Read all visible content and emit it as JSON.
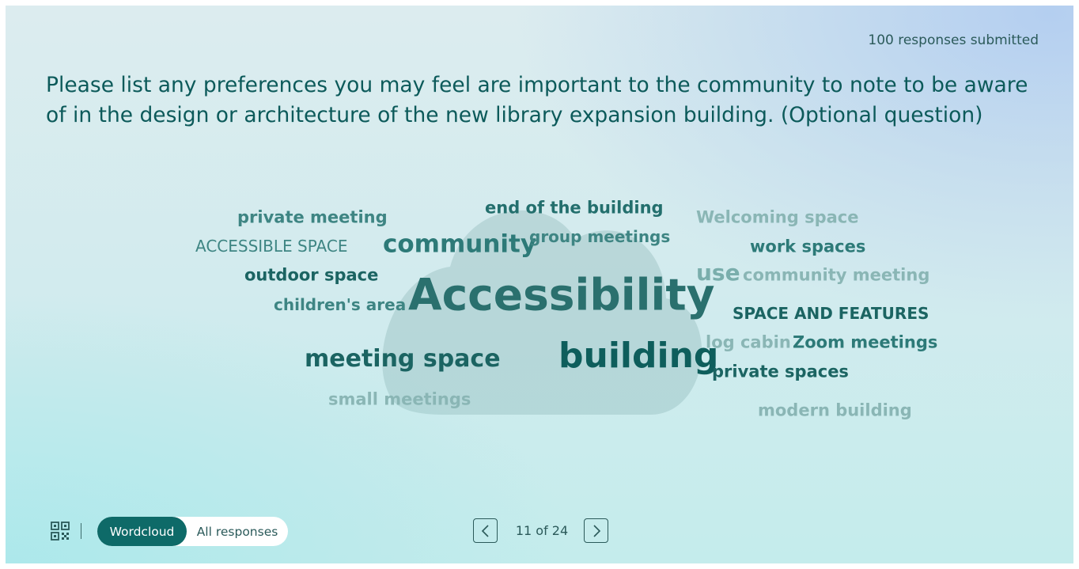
{
  "header": {
    "responses_text": "100 responses submitted",
    "question": "Please list any preferences you may feel are important to the community to note to be aware of in the design or architecture of the new library expansion building. (Optional question)"
  },
  "wordcloud": {
    "words": [
      {
        "text": "private meeting",
        "color": "#3e8583"
      },
      {
        "text": "end of the building",
        "color": "#236f6d"
      },
      {
        "text": "Welcoming space",
        "color": "#8ab6b5"
      },
      {
        "text": "ACCESSIBLE SPACE",
        "color": "#3e8583"
      },
      {
        "text": "community",
        "color": "#2d7a78"
      },
      {
        "text": "group meetings",
        "color": "#3e8583"
      },
      {
        "text": "work spaces",
        "color": "#2d7a78"
      },
      {
        "text": "outdoor space",
        "color": "#1b6462"
      },
      {
        "text": "use",
        "color": "#7aaeac"
      },
      {
        "text": "community meeting",
        "color": "#8ab6b5"
      },
      {
        "text": "children's area",
        "color": "#3e8583"
      },
      {
        "text": "Accessibility",
        "color": "#2a706e"
      },
      {
        "text": "SPACE AND FEATURES",
        "color": "#1b6462"
      },
      {
        "text": "meeting space",
        "color": "#1b6462"
      },
      {
        "text": "building",
        "color": "#0e5e5c"
      },
      {
        "text": "log cabin",
        "color": "#8ab6b5"
      },
      {
        "text": "Zoom meetings",
        "color": "#2d7a78"
      },
      {
        "text": "private spaces",
        "color": "#1b6462"
      },
      {
        "text": "small meetings",
        "color": "#8ab6b5"
      },
      {
        "text": "modern building",
        "color": "#8ab6b5"
      }
    ]
  },
  "footer": {
    "qr_icon": "qr-code-icon",
    "view_toggle": {
      "active_label": "Wordcloud",
      "inactive_label": "All responses"
    },
    "pager": {
      "text": "11 of 24",
      "prev_icon": "chevron-left-icon",
      "next_icon": "chevron-right-icon"
    }
  },
  "colors": {
    "accent": "#0e6a68",
    "text_dark": "#0c5a5a"
  }
}
